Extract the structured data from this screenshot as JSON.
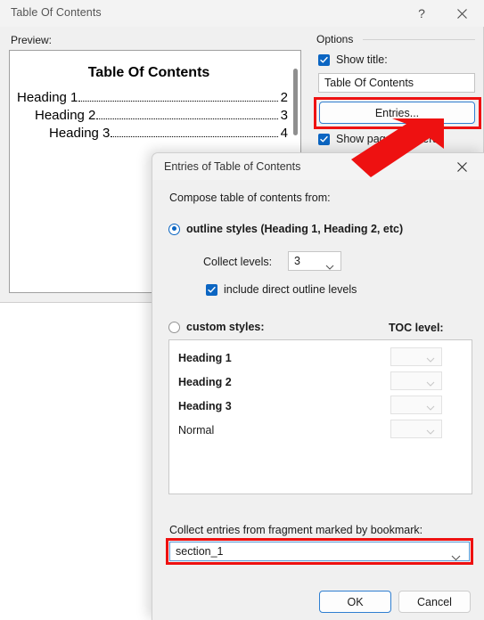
{
  "outer_dialog": {
    "title": "Table Of Contents",
    "help_icon": "?",
    "close_icon": "close-icon",
    "preview_label": "Preview:",
    "preview": {
      "heading": "Table Of Contents",
      "entries": [
        {
          "text": "Heading 1",
          "page": "2",
          "indent": 0
        },
        {
          "text": "Heading 2",
          "page": "3",
          "indent": 1
        },
        {
          "text": "Heading 3",
          "page": "4",
          "indent": 2
        }
      ]
    },
    "options": {
      "legend": "Options",
      "show_title_label": "Show title:",
      "show_title_checked": true,
      "title_value": "Table Of Contents",
      "entries_button": "Entries...",
      "show_page_numbers_label": "Show page numbers",
      "show_page_numbers_checked": true
    }
  },
  "inner_dialog": {
    "title": "Entries of Table of Contents",
    "close_icon": "close-icon",
    "compose_label": "Compose table of contents from:",
    "outline_radio_label": "outline styles (Heading 1, Heading 2, etc)",
    "outline_radio_selected": true,
    "collect_levels_label": "Collect levels:",
    "collect_levels_value": "3",
    "include_direct_label": "include direct outline levels",
    "include_direct_checked": true,
    "custom_radio_label": "custom styles:",
    "custom_radio_selected": false,
    "toc_level_header": "TOC level:",
    "styles": [
      {
        "name": "Heading 1",
        "bold": true,
        "toc_level": ""
      },
      {
        "name": "Heading 2",
        "bold": true,
        "toc_level": ""
      },
      {
        "name": "Heading 3",
        "bold": true,
        "toc_level": ""
      },
      {
        "name": "Normal",
        "bold": false,
        "toc_level": ""
      }
    ],
    "bookmark_label": "Collect entries from fragment marked by bookmark:",
    "bookmark_value": "section_1",
    "ok_button": "OK",
    "cancel_button": "Cancel"
  },
  "annotations": {
    "highlight_color": "#ee1111",
    "arrow_color": "#ee1111",
    "arrow_from": "Entries... button",
    "arrow_to": "Entries of Table of Contents dialog"
  },
  "colors": {
    "accent": "#0b65c2",
    "dialog_bg": "#f0f0f0",
    "titlebar_bg": "#f3f3f3",
    "highlight": "#ee1111"
  }
}
